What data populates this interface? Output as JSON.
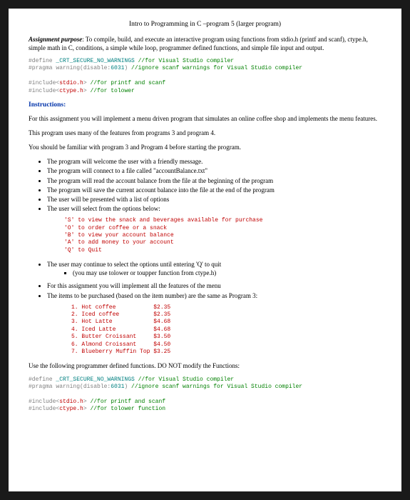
{
  "title": "Intro to Programming in C –program 5 (larger program)",
  "purpose_label": "Assignment purpose",
  "purpose_text": ": To compile, build, and execute an interactive program using functions from stdio.h (printf and scanf), ctype.h, simple math in C, conditions, a simple while loop, programmer defined functions, and simple file input and output.",
  "code1": {
    "define_kw": "#define ",
    "define_sym": "_CRT_SECURE_NO_WARNINGS",
    "define_cmt": " //for Visual Studio compiler",
    "pragma": "#pragma warning(disable:",
    "pragma_num": "6031",
    "pragma_rest": ") ",
    "pragma_cmt": "//ignore scanf warnings for Visual Studio compiler",
    "inc1a": "#include<",
    "inc1b": "stdio.h",
    "inc1c": "> ",
    "inc1_cmt": "//for printf and scanf",
    "inc2a": "#include<",
    "inc2b": "ctype.h",
    "inc2c": "> ",
    "inc2_cmt": "//for tolower"
  },
  "instructions_hdr": "Instructions:",
  "p1": "For this assignment you will implement a menu driven program that simulates an online coffee shop and implements the menu features.",
  "p2": "This program uses many of the features from programs 3 and program 4.",
  "p3": "You should be familiar with program 3 and Program 4 before starting the program.",
  "bullets1": [
    "The program will welcome the user with a friendly message.",
    "The program will connect to a file called \"accountBalance.txt\"",
    "The program will read the account balance from the file at the beginning of the program",
    "The program will save the current account balance into the file at the end of the program",
    "The user will be presented with a list of options",
    "The user will select from the options below:"
  ],
  "menu_code": "'S' to view the snack and beverages available for purchase\n'O' to order coffee or a snack\n'B' to view your account balance\n'A' to add money to your account\n'Q' to Quit",
  "bullets2": [
    "The user may continue to select the options until entering 'Q' to quit"
  ],
  "sub_bullet": "(you may use tolower or toupper function from ctype.h)",
  "bullets3": [
    "For this assignment you will  implement all the features of the menu",
    "The items to be purchased (based on the item number) are the same as Program 3:"
  ],
  "items_code": "1. Hot coffee           $2.35\n2. Iced coffee          $2.35\n3. Hot Latte            $4.68\n4. Iced Latte           $4.68\n5. Butter Croissant     $3.50\n6. Almond Croissant     $4.50\n7. Blueberry Muffin Top $3.25",
  "p4": "Use the following programmer defined functions. DO NOT modify the Functions:",
  "code2": {
    "define_kw": "#define ",
    "define_sym": "_CRT_SECURE_NO_WARNINGS",
    "define_cmt": " //for Visual Studio compiler",
    "pragma": "#pragma warning(disable:",
    "pragma_num": "6031",
    "pragma_rest": ") ",
    "pragma_cmt": "//ignore scanf warnings for Visual Studio compiler",
    "inc1a": "#include<",
    "inc1b": "stdio.h",
    "inc1c": "> ",
    "inc1_cmt": "//for printf and scanf",
    "inc2a": "#include<",
    "inc2b": "ctype.h",
    "inc2c": "> ",
    "inc2_cmt": "//for tolower function"
  }
}
